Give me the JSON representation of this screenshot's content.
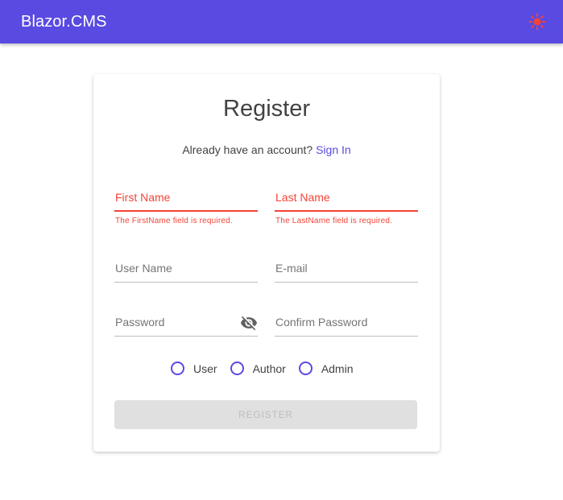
{
  "app": {
    "title": "Blazor.CMS",
    "theme_icon": "sun-icon",
    "accent_color": "#594ae2",
    "error_color": "#f44336"
  },
  "form": {
    "title": "Register",
    "subtitle_prefix": "Already have an account?",
    "signin_link": "Sign In",
    "fields": {
      "first_name": {
        "label": "First Name",
        "error": "The FirstName field is required."
      },
      "last_name": {
        "label": "Last Name",
        "error": "The LastName field is required."
      },
      "user_name": {
        "label": "User Name"
      },
      "email": {
        "label": "E-mail"
      },
      "password": {
        "label": "Password",
        "icon": "eye-off-icon"
      },
      "confirm_password": {
        "label": "Confirm Password"
      }
    },
    "roles": [
      "User",
      "Author",
      "Admin"
    ],
    "submit_label": "REGISTER"
  }
}
